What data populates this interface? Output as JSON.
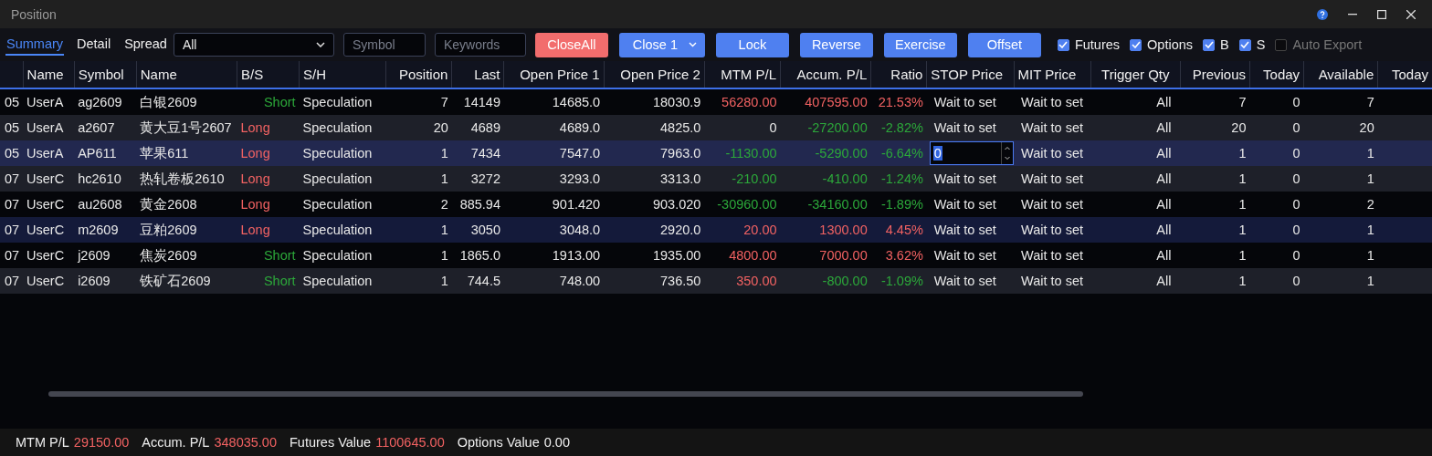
{
  "window": {
    "title": "Position"
  },
  "tabs": [
    {
      "label": "Summary",
      "selected": true
    },
    {
      "label": "Detail",
      "selected": false
    },
    {
      "label": "Spread",
      "selected": false
    }
  ],
  "filter": {
    "value": "All"
  },
  "symbol_field": {
    "placeholder": "Symbol"
  },
  "keywords_field": {
    "placeholder": "Keywords"
  },
  "buttons": [
    {
      "label": "CloseAll",
      "kind": "danger"
    },
    {
      "label": "Close 1",
      "kind": "split"
    },
    {
      "label": "Lock",
      "kind": "primary"
    },
    {
      "label": "Reverse",
      "kind": "primary"
    },
    {
      "label": "Exercise",
      "kind": "primary"
    },
    {
      "label": "Offset",
      "kind": "primary"
    }
  ],
  "checkboxes": [
    {
      "label": "Futures",
      "checked": true,
      "disabled": false
    },
    {
      "label": "Options",
      "checked": true,
      "disabled": false
    },
    {
      "label": "B",
      "checked": true,
      "disabled": false
    },
    {
      "label": "S",
      "checked": true,
      "disabled": false
    },
    {
      "label": "Auto Export",
      "checked": false,
      "disabled": true
    }
  ],
  "table": {
    "columns": [
      "",
      "Name",
      "Symbol",
      "Name",
      "B/S",
      "S/H",
      "Position",
      "Last",
      "Open Price 1",
      "Open Price 2",
      "MTM P/L",
      "Accum. P/L",
      "Ratio",
      "STOP Price",
      "MIT Price",
      "Trigger Qty",
      "Previous",
      "Today",
      "Available",
      "Today"
    ],
    "rows": [
      {
        "selected": false,
        "hovered": false,
        "cells": [
          {
            "text": "05"
          },
          {
            "text": "UserA"
          },
          {
            "text": "ag2609"
          },
          {
            "text": "白银2609"
          },
          {
            "text": "Short",
            "color": "#2ca83a"
          },
          {
            "text": "Speculation"
          },
          {
            "text": "7"
          },
          {
            "text": "14149"
          },
          {
            "text": "14685.0"
          },
          {
            "text": "18030.9"
          },
          {
            "text": "56280.00",
            "color": "#f26262"
          },
          {
            "text": "407595.00",
            "color": "#f26262"
          },
          {
            "text": "21.53%",
            "color": "#f26262"
          },
          {
            "text": "Wait to set"
          },
          {
            "text": "Wait to set"
          },
          {
            "text": "All"
          },
          {
            "text": "7"
          },
          {
            "text": "0"
          },
          {
            "text": "7"
          }
        ]
      },
      {
        "selected": false,
        "hovered": false,
        "cells": [
          {
            "text": "05"
          },
          {
            "text": "UserA"
          },
          {
            "text": "a2607"
          },
          {
            "text": "黄大豆1号2607"
          },
          {
            "text": "Long",
            "color": "#f26262"
          },
          {
            "text": "Speculation"
          },
          {
            "text": "20"
          },
          {
            "text": "4689"
          },
          {
            "text": "4689.0"
          },
          {
            "text": "4825.0"
          },
          {
            "text": "0"
          },
          {
            "text": "-27200.00",
            "color": "#2ca83a"
          },
          {
            "text": "-2.82%",
            "color": "#2ca83a"
          },
          {
            "text": "Wait to set"
          },
          {
            "text": "Wait to set"
          },
          {
            "text": "All"
          },
          {
            "text": "20"
          },
          {
            "text": "0"
          },
          {
            "text": "20"
          }
        ]
      },
      {
        "selected": true,
        "hovered": false,
        "cells": [
          {
            "text": "05"
          },
          {
            "text": "UserA"
          },
          {
            "text": "AP611"
          },
          {
            "text": "苹果611"
          },
          {
            "text": "Long",
            "color": "#f26262"
          },
          {
            "text": "Speculation"
          },
          {
            "text": "1"
          },
          {
            "text": "7434"
          },
          {
            "text": "7547.0"
          },
          {
            "text": "7963.0"
          },
          {
            "text": "-1130.00",
            "color": "#2ca83a"
          },
          {
            "text": "-5290.00",
            "color": "#2ca83a"
          },
          {
            "text": "-6.64%",
            "color": "#2ca83a"
          },
          {
            "text": "0",
            "kind": "input"
          },
          {
            "text": "Wait to set"
          },
          {
            "text": "All"
          },
          {
            "text": "1"
          },
          {
            "text": "0"
          },
          {
            "text": "1"
          }
        ]
      },
      {
        "selected": false,
        "hovered": false,
        "cells": [
          {
            "text": "07"
          },
          {
            "text": "UserC"
          },
          {
            "text": "hc2610"
          },
          {
            "text": "热轧卷板2610"
          },
          {
            "text": "Long",
            "color": "#f26262"
          },
          {
            "text": "Speculation"
          },
          {
            "text": "1"
          },
          {
            "text": "3272"
          },
          {
            "text": "3293.0"
          },
          {
            "text": "3313.0"
          },
          {
            "text": "-210.00",
            "color": "#2ca83a"
          },
          {
            "text": "-410.00",
            "color": "#2ca83a"
          },
          {
            "text": "-1.24%",
            "color": "#2ca83a"
          },
          {
            "text": "Wait to set"
          },
          {
            "text": "Wait to set"
          },
          {
            "text": "All"
          },
          {
            "text": "1"
          },
          {
            "text": "0"
          },
          {
            "text": "1"
          }
        ]
      },
      {
        "selected": false,
        "hovered": false,
        "cells": [
          {
            "text": "07"
          },
          {
            "text": "UserC"
          },
          {
            "text": "au2608"
          },
          {
            "text": "黄金2608"
          },
          {
            "text": "Long",
            "color": "#f26262"
          },
          {
            "text": "Speculation"
          },
          {
            "text": "2"
          },
          {
            "text": "885.94"
          },
          {
            "text": "901.420"
          },
          {
            "text": "903.020"
          },
          {
            "text": "-30960.00",
            "color": "#2ca83a"
          },
          {
            "text": "-34160.00",
            "color": "#2ca83a"
          },
          {
            "text": "-1.89%",
            "color": "#2ca83a"
          },
          {
            "text": "Wait to set"
          },
          {
            "text": "Wait to set"
          },
          {
            "text": "All"
          },
          {
            "text": "1"
          },
          {
            "text": "0"
          },
          {
            "text": "2"
          }
        ]
      },
      {
        "selected": false,
        "hovered": true,
        "cells": [
          {
            "text": "07"
          },
          {
            "text": "UserC"
          },
          {
            "text": "m2609"
          },
          {
            "text": "豆粕2609"
          },
          {
            "text": "Long",
            "color": "#f26262"
          },
          {
            "text": "Speculation"
          },
          {
            "text": "1"
          },
          {
            "text": "3050"
          },
          {
            "text": "3048.0"
          },
          {
            "text": "2920.0"
          },
          {
            "text": "20.00",
            "color": "#f26262"
          },
          {
            "text": "1300.00",
            "color": "#f26262"
          },
          {
            "text": "4.45%",
            "color": "#f26262"
          },
          {
            "text": "Wait to set"
          },
          {
            "text": "Wait to set"
          },
          {
            "text": "All"
          },
          {
            "text": "1"
          },
          {
            "text": "0"
          },
          {
            "text": "1"
          }
        ]
      },
      {
        "selected": false,
        "hovered": false,
        "cells": [
          {
            "text": "07"
          },
          {
            "text": "UserC"
          },
          {
            "text": "j2609"
          },
          {
            "text": "焦炭2609"
          },
          {
            "text": "Short",
            "color": "#2ca83a"
          },
          {
            "text": "Speculation"
          },
          {
            "text": "1"
          },
          {
            "text": "1865.0"
          },
          {
            "text": "1913.00"
          },
          {
            "text": "1935.00"
          },
          {
            "text": "4800.00",
            "color": "#f26262"
          },
          {
            "text": "7000.00",
            "color": "#f26262"
          },
          {
            "text": "3.62%",
            "color": "#f26262"
          },
          {
            "text": "Wait to set"
          },
          {
            "text": "Wait to set"
          },
          {
            "text": "All"
          },
          {
            "text": "1"
          },
          {
            "text": "0"
          },
          {
            "text": "1"
          }
        ]
      },
      {
        "selected": false,
        "hovered": false,
        "cells": [
          {
            "text": "07"
          },
          {
            "text": "UserC"
          },
          {
            "text": "i2609"
          },
          {
            "text": "铁矿石2609"
          },
          {
            "text": "Short",
            "color": "#2ca83a"
          },
          {
            "text": "Speculation"
          },
          {
            "text": "1"
          },
          {
            "text": "744.5"
          },
          {
            "text": "748.00"
          },
          {
            "text": "736.50"
          },
          {
            "text": "350.00",
            "color": "#f26262"
          },
          {
            "text": "-800.00",
            "color": "#2ca83a"
          },
          {
            "text": "-1.09%",
            "color": "#2ca83a"
          },
          {
            "text": "Wait to set"
          },
          {
            "text": "Wait to set"
          },
          {
            "text": "All"
          },
          {
            "text": "1"
          },
          {
            "text": "0"
          },
          {
            "text": "1"
          }
        ]
      }
    ]
  },
  "status_bar": [
    {
      "label": "MTM P/L",
      "value": "29150.00",
      "color": "#f26262"
    },
    {
      "label": "Accum. P/L",
      "value": "348035.00",
      "color": "#f26262"
    },
    {
      "label": "Futures Value",
      "value": "1100645.00",
      "color": "#f26262"
    },
    {
      "label": "Options Value",
      "value": "0.00"
    }
  ]
}
